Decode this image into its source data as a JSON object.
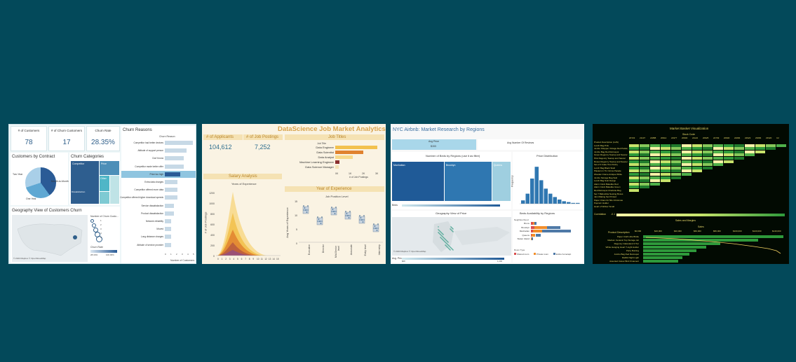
{
  "churn": {
    "kpis": [
      {
        "label": "# of Customers",
        "value": "78"
      },
      {
        "label": "# of Churn Customers",
        "value": "17"
      },
      {
        "label": "Churn Rate",
        "value": "28.35%"
      }
    ],
    "reasons_title": "Churn Reasons",
    "reasons_header": "Churn Reason",
    "reasons": [
      "Competitor had better devices",
      "Attitude of support person",
      "Don't know",
      "Competitor made better offer",
      "Price too high",
      "Extra data charges",
      "Competitor offered more data",
      "Competitor offered higher download speeds",
      "Service dissatisfaction",
      "Product dissatisfaction",
      "Network reliability",
      "Moved",
      "Long distance charges",
      "Attitude of service provider"
    ],
    "reasons_values": [
      9,
      7,
      6,
      6,
      5,
      4,
      4,
      4,
      3,
      3,
      2,
      2,
      2,
      2
    ],
    "reasons_axis": [
      "0",
      "1",
      "2",
      "3",
      "4",
      "5"
    ],
    "reasons_xlabel": "Number of Customers",
    "contract_title": "Customers by Contract",
    "contract_labels": [
      "Two Year",
      "Month-to-Month",
      "One Year"
    ],
    "categories_title": "Churn Categories",
    "categories_labels": [
      "Competitor",
      "Price",
      "Other",
      "Dissatisfaction",
      "Attitude"
    ],
    "geo_title": "Geography View of Customers Churn",
    "geo_legend_title": "Number of Churn Custo...",
    "geo_legend_items": [
      "1",
      "2",
      "3",
      "4",
      "5"
    ],
    "churn_rate_label": "Churn Rate",
    "churn_rate_range": [
      "28.34%",
      "100.00%"
    ],
    "map_credit": "© 2023 Mapbox © OpenStreetMap"
  },
  "jobs": {
    "title": "DataScience Job Market Analytics",
    "kpis": [
      {
        "label": "# of Applicants",
        "value": "104,612"
      },
      {
        "label": "# of Job Postings",
        "value": "7,252"
      }
    ],
    "titles_header": "Job Titles",
    "job_title_label": "Job Title",
    "job_titles": [
      "Data Engineer",
      "Data Scientist",
      "Data Analyst",
      "Machine Learning Engineer",
      "Data Science Manager"
    ],
    "job_values": [
      3200,
      2100,
      1300,
      300,
      250
    ],
    "job_colors": [
      "#f2c14e",
      "#e0822f",
      "#f7d98b",
      "#8b2f2f",
      "#f3e2b5"
    ],
    "titles_axis": [
      "0K",
      "1K",
      "2K",
      "3K"
    ],
    "titles_xlabel": "# of Job Postings",
    "salary_header": "Salary Analysis",
    "salary_subtitle": "Years of Experience",
    "salary_ylabel": "# of Job Postings",
    "salary_yticks": [
      "1200",
      "1000",
      "800",
      "600",
      "400",
      "200",
      "0"
    ],
    "salary_xticks": [
      "0",
      "1",
      "2",
      "3",
      "4",
      "5",
      "6",
      "7",
      "8",
      "9",
      "10",
      "11",
      "12",
      "13",
      "14",
      "15"
    ],
    "exp_header": "Year of Experience",
    "exp_subtitle": "Job Position Level",
    "exp_ylabel": "Avg Years of Experience",
    "exp_levels": [
      "Executive",
      "Director",
      "Mid-Senior level",
      "Associate",
      "Entry level",
      "Internship"
    ],
    "exp_yticks": [
      "15",
      "10",
      "5",
      "0"
    ]
  },
  "airbnb": {
    "title": "NYC Airbnb: Market Research by Regions",
    "avg_price_label": "Avg Price",
    "avg_price_value": "$153",
    "avg_reviews_label": "Avg Number Of Reviews",
    "beds_title": "Number of Beds by Regions (use it as filter)",
    "regions": [
      "Manhattan",
      "Brooklyn",
      "Queens"
    ],
    "region_values": [
      44,
      40,
      16
    ],
    "price_dist_title": "Price Distribution",
    "price_dist_ylabel": "Frequency",
    "price_hist": [
      4,
      12,
      30,
      44,
      28,
      18,
      12,
      8,
      5,
      3,
      2,
      1,
      1
    ],
    "beds_label": "Beds",
    "geo_title": "Geography View of Price",
    "map_credit": "© 2023 Mapbox © OpenStreetMap",
    "avg_price_legend": "Avg. Price",
    "avg_price_range": [
      "$68",
      "1,200"
    ],
    "availability_title": "Beds Availability by Regions",
    "neighbourhood_label": "Neighbourhood",
    "neighbourhoods": [
      "Bronx",
      "Brooklyn",
      "Manhattan",
      "Queens",
      "Staten Island"
    ],
    "room_type_label": "Room Type",
    "room_types": [
      "Shared room",
      "Private room",
      "Entire home/apt"
    ],
    "room_colors": [
      "#d94e4e",
      "#f28e2b",
      "#4e79a7"
    ]
  },
  "market": {
    "title": "Market Basket Visualization",
    "subtitle": "Stock Code",
    "column_codes": [
      "20723",
      "21137",
      "21888",
      "20914",
      "21977",
      "20900",
      "21122",
      "20925",
      "22739",
      "20900",
      "22084",
      "22923",
      "23084",
      "23320",
      "C2"
    ],
    "row_labels": [
      "Product Description (LHS)",
      "Lunch Bag Pink",
      "Jumbo Shopper Vintage Red Paisley",
      "Jumbo Bag Red Retrospot",
      "Green Regency Teacup and Saucer",
      "Pink Regency Teacup and Saucer",
      "Roses Regency Teacup and Saucer",
      "Set of 3 Cake Tins Pantry",
      "Lunch Bag Black Skull",
      "Plasters in Tin Circus Parade",
      "Wooden Frame Antique White",
      "Jumbo Storage Bag Suki",
      "Lunch Bag Suki Design",
      "Alarm Clock Bakelike Red",
      "Alarm Clock Bakelike Green",
      "Red Retrospot Charlotte Bag",
      "Set 7 Babushka Nesting Boxes",
      "Jam Making Set Printed",
      "Paper Chain Kit 50s Christmas",
      "Popcorn Holder",
      "Heart of Wicker Small"
    ],
    "correlation_label": "Correlation",
    "correlation_min": "-0.1",
    "sales_title": "Sales and Margins",
    "sales_subtitle": "Sales",
    "product_desc_label": "Product Description",
    "sales_axis": [
      "$0,000",
      "$20,000",
      "$40,000",
      "$60,000",
      "$80,000",
      "$100,000",
      "$120,000",
      "$140,000"
    ],
    "products": [
      "Paper Craft Little Birdie",
      "Medium Ceramic Top Storage Jar",
      "Regency Cakestand 3 Tier",
      "White Hanging Heart T-Light Holder",
      "Party Bunting",
      "Jumbo Bag Red Retrospot",
      "Rabbit Night Light",
      "Assorted Colour Bird Ornament"
    ],
    "product_values": [
      1.0,
      0.82,
      0.55,
      0.45,
      0.38,
      0.33,
      0.28,
      0.25
    ]
  }
}
